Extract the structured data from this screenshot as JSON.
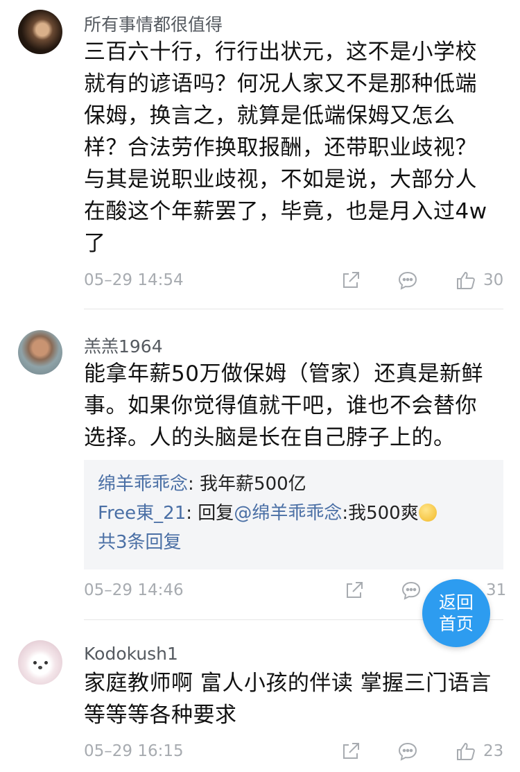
{
  "comments": [
    {
      "user": "所有事情都很值得",
      "lines": [
        "三百六十行，行行出状元，这不是小学校",
        "就有的谚语吗？何况人家又不是那种低端",
        "保姆，换言之，就算是低端保姆又怎么",
        "样？合法劳作换取报酬，还带职业歧视？",
        "与其是说职业歧视，不如是说，大部分人",
        "在酸这个年薪罢了，毕竟，也是月入过4w",
        "了"
      ],
      "time": "05–29 14:54",
      "likes": "30"
    },
    {
      "user": "羔羔1964",
      "lines": [
        "能拿年薪50万做保姆（管家）还真是新鲜",
        "事。如果你觉得值就干吧，谁也不会替你",
        "选择。人的头脑是长在自己脖子上的。"
      ],
      "replies": [
        {
          "name": "绵羊乖乖念",
          "sep": ": ",
          "text": "我年薪500亿"
        },
        {
          "name": "Free東_21",
          "sep": ": ",
          "prefix": "回复",
          "mention": "@绵羊乖乖念",
          "text": ":我500爽"
        }
      ],
      "more": "共3条回复",
      "time": "05–29 14:46",
      "likes": "31"
    },
    {
      "user": "Kodokush1",
      "lines": [
        "家庭教师啊 富人小孩的伴读 掌握三门语言",
        "等等等各种要求"
      ],
      "time": "05–29 16:15",
      "likes": "23"
    }
  ],
  "back_button": {
    "line1": "返回",
    "line2": "首页"
  },
  "icons": {
    "share": "share-icon",
    "reply": "comment-icon",
    "like": "thumbs-up-icon"
  },
  "colors": {
    "accent": "#2d9cf0",
    "link": "#4a6fa5",
    "meta": "#a7abb0"
  }
}
